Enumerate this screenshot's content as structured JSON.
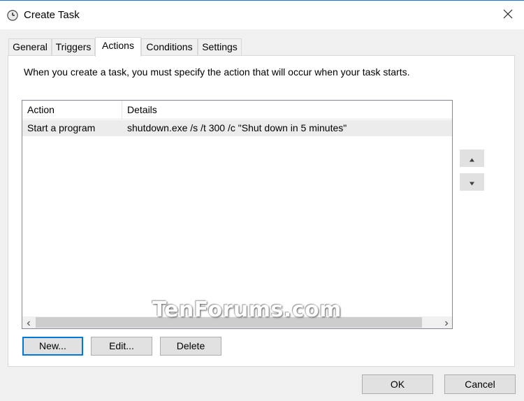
{
  "window": {
    "title": "Create Task",
    "icon": "clock-icon",
    "close_symbol": "close-icon"
  },
  "tabs": [
    {
      "label": "General",
      "active": false
    },
    {
      "label": "Triggers",
      "active": false
    },
    {
      "label": "Actions",
      "active": true
    },
    {
      "label": "Conditions",
      "active": false
    },
    {
      "label": "Settings",
      "active": false
    }
  ],
  "actions_panel": {
    "description": "When you create a task, you must specify the action that will occur when your task starts.",
    "columns": [
      "Action",
      "Details"
    ],
    "rows": [
      {
        "action": "Start a program",
        "details": "shutdown.exe /s /t 300 /c \"Shut down in 5 minutes\""
      }
    ],
    "buttons": {
      "new": "New...",
      "edit": "Edit...",
      "delete": "Delete"
    }
  },
  "footer": {
    "ok": "OK",
    "cancel": "Cancel"
  },
  "watermark": "TenForums.com",
  "colors": {
    "accent": "#0078d7",
    "selected_row": "#ececec",
    "button_face": "#e1e1e1"
  }
}
